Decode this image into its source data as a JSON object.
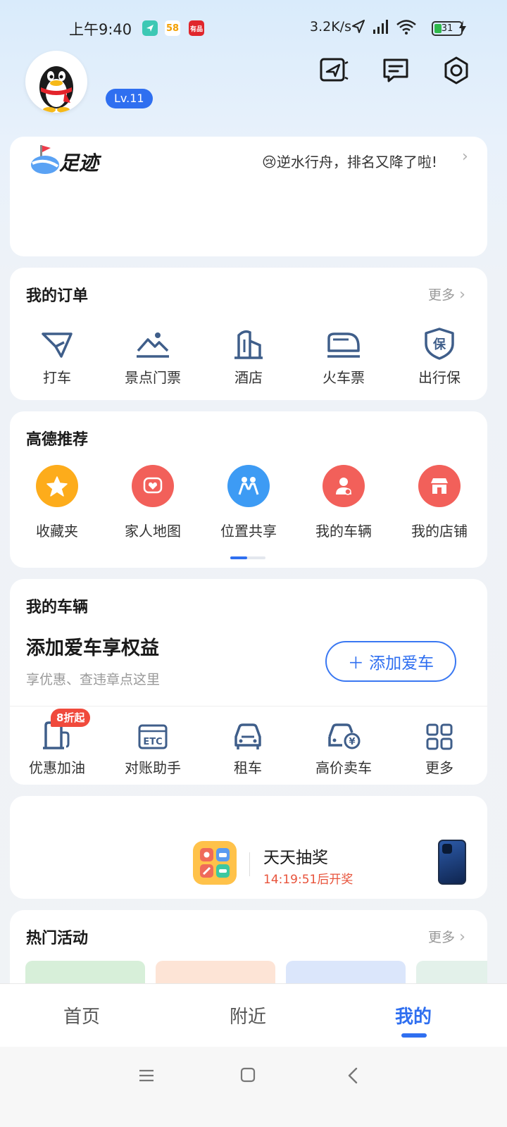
{
  "status_bar": {
    "time": "上午9:40",
    "app_badges": [
      "58",
      "有品"
    ],
    "net_speed": "3.2K/s",
    "battery": "31"
  },
  "profile": {
    "level": "Lv.11"
  },
  "footprint": {
    "title": "足迹",
    "rank_text": "😢逆水行舟，排名又降了啦!",
    "chevron": "›"
  },
  "orders": {
    "title": "我的订单",
    "more": "更多",
    "chevron": "›",
    "items": [
      {
        "label": "打车",
        "icon": "taxi-icon"
      },
      {
        "label": "景点门票",
        "icon": "scenic-ticket-icon"
      },
      {
        "label": "酒店",
        "icon": "hotel-icon"
      },
      {
        "label": "火车票",
        "icon": "train-icon"
      },
      {
        "label": "出行保",
        "icon": "insurance-shield-icon"
      }
    ]
  },
  "recommend": {
    "title": "高德推荐",
    "items": [
      {
        "label": "收藏夹",
        "icon": "star-icon",
        "color": "#fdac1b"
      },
      {
        "label": "家人地图",
        "icon": "family-heart-icon",
        "color": "#f2605a"
      },
      {
        "label": "位置共享",
        "icon": "people-share-icon",
        "color": "#3d9bf4"
      },
      {
        "label": "我的车辆",
        "icon": "driver-icon",
        "color": "#f2605a"
      },
      {
        "label": "我的店铺",
        "icon": "shop-icon",
        "color": "#f2605a"
      }
    ]
  },
  "vehicle": {
    "title": "我的车辆",
    "headline": "添加爱车享权益",
    "subtext": "享优惠、查违章点这里",
    "add_button": "＋ 添加爱车",
    "badge": "8折起",
    "services": [
      {
        "label": "优惠加油",
        "icon": "fuel-pump-icon"
      },
      {
        "label": "对账助手",
        "icon": "etc-icon"
      },
      {
        "label": "租车",
        "icon": "car-rental-icon"
      },
      {
        "label": "高价卖车",
        "icon": "sell-car-icon"
      },
      {
        "label": "更多",
        "icon": "grid-more-icon"
      }
    ],
    "etc_text": "ETC"
  },
  "lottery": {
    "title": "天天抽奖",
    "countdown": "14:19:51后开奖"
  },
  "events": {
    "title": "热门活动",
    "more": "更多",
    "chevron": "›"
  },
  "tabbar": {
    "tabs": [
      "首页",
      "附近",
      "我的"
    ],
    "active": "我的"
  },
  "colors": {
    "accent": "#2f6ff0",
    "countdown": "#e8533b"
  }
}
